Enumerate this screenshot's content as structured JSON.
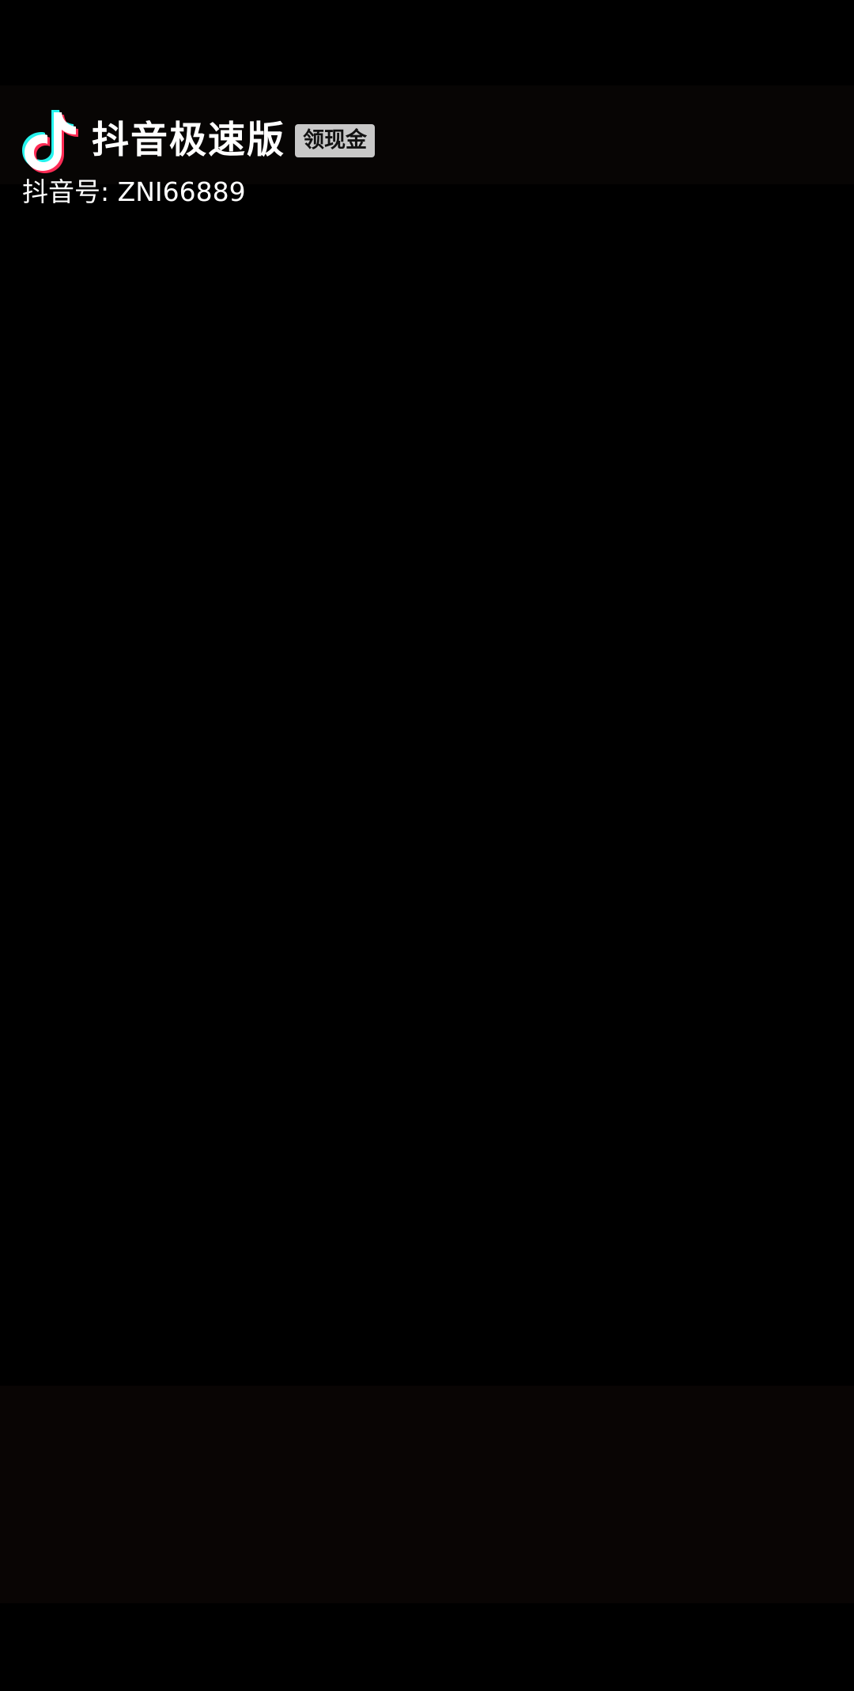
{
  "watermark": {
    "logo_icon": "douyin-note-icon",
    "app_name": "抖音极速版",
    "badge_label": "领现金",
    "account_id_text": "抖音号: ZNI66889"
  },
  "colors": {
    "background": "#000000",
    "logo_cyan": "#25f4ee",
    "logo_red": "#fe2c55",
    "logo_white": "#ffffff",
    "badge_bg": "#c8c8c8"
  }
}
